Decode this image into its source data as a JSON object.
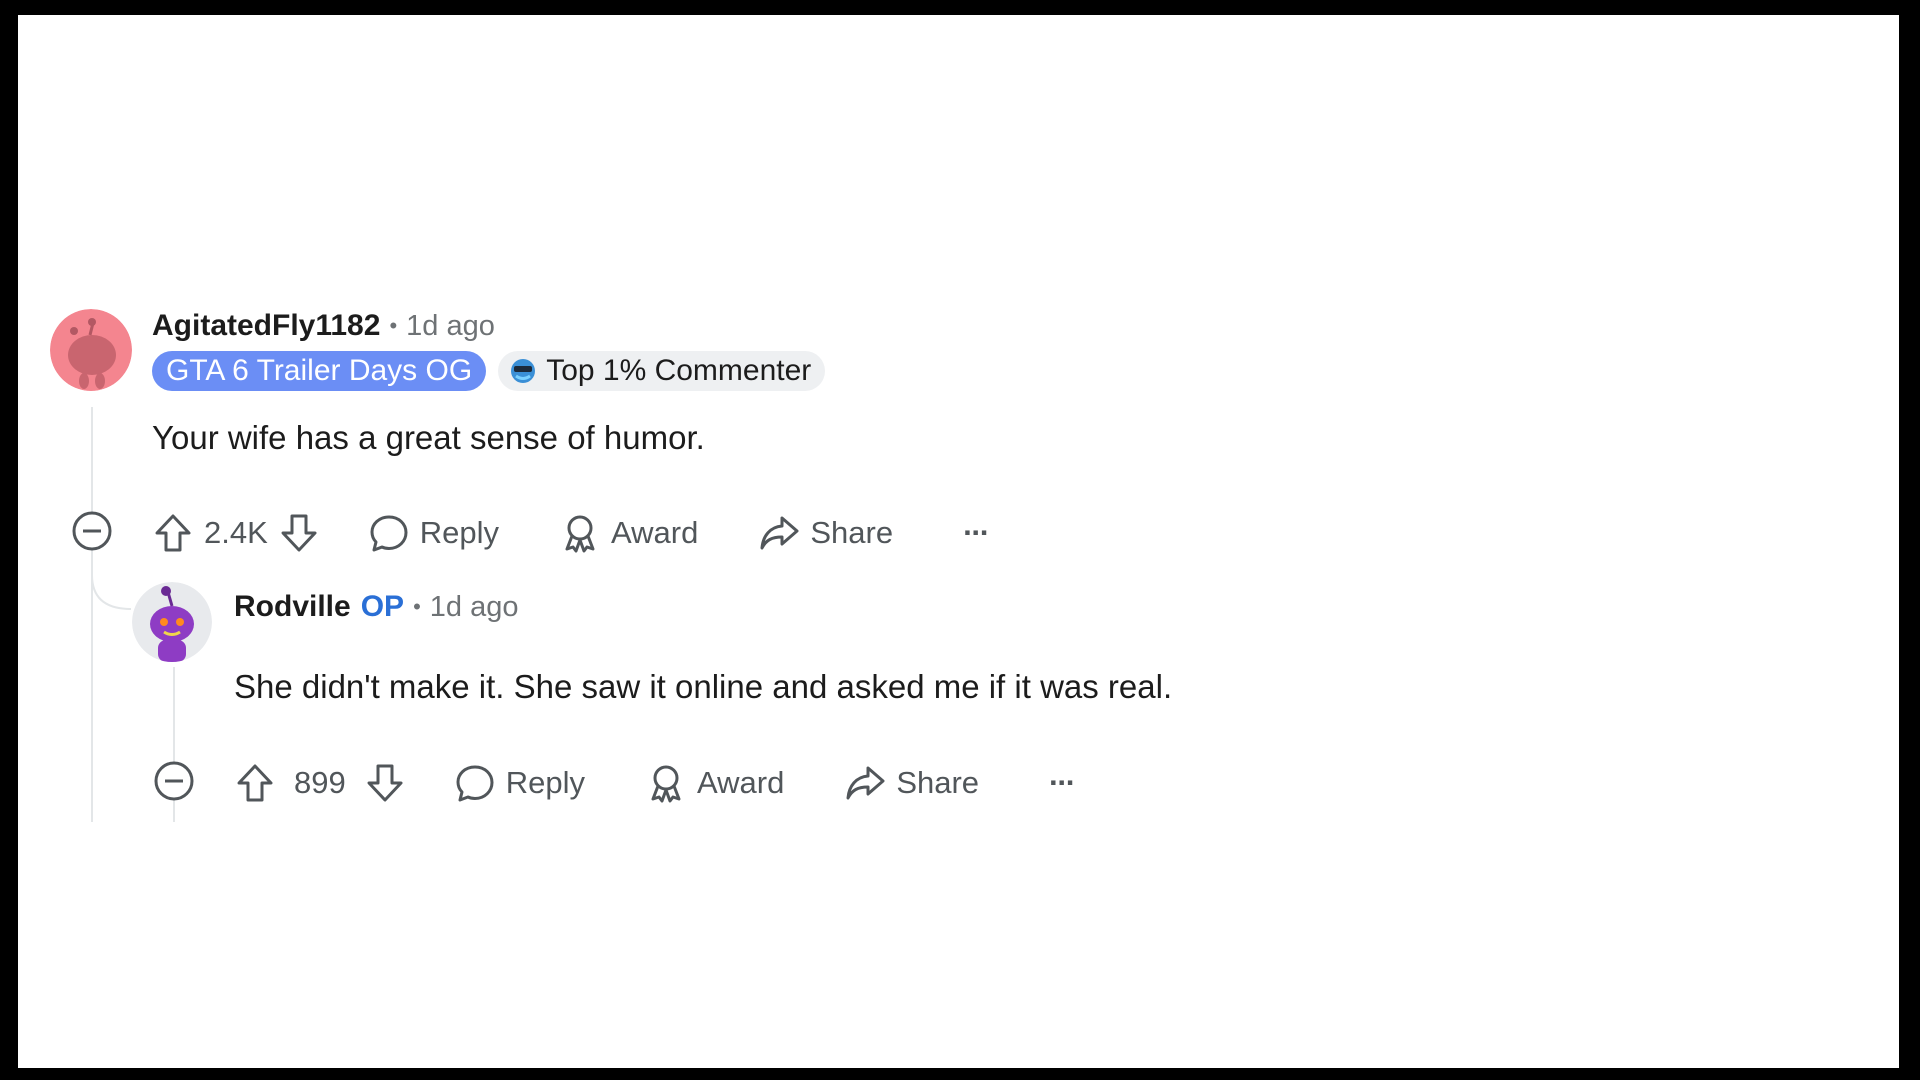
{
  "comments": [
    {
      "username": "AgitatedFly1182",
      "time": "1d ago",
      "flairs": {
        "custom": "GTA 6 Trailer Days OG",
        "achievement": "Top 1% Commenter"
      },
      "text": "Your wife has a great sense of humor.",
      "votes": "2.4K",
      "avatar_color": "#f4858f",
      "actions": {
        "reply": "Reply",
        "award": "Award",
        "share": "Share",
        "more": "···"
      }
    },
    {
      "username": "Rodville",
      "op_label": "OP",
      "time": "1d ago",
      "text": "She didn't make it. She saw it online and asked me if it was real.",
      "votes": "899",
      "avatar_color": "#8e3cc4",
      "actions": {
        "reply": "Reply",
        "award": "Award",
        "share": "Share",
        "more": "···"
      }
    }
  ],
  "colors": {
    "accent_flair": "#6b8ef5",
    "op": "#2a6fd6",
    "text": "#1c1c1c",
    "meta": "#6e7275"
  },
  "separator": "•"
}
